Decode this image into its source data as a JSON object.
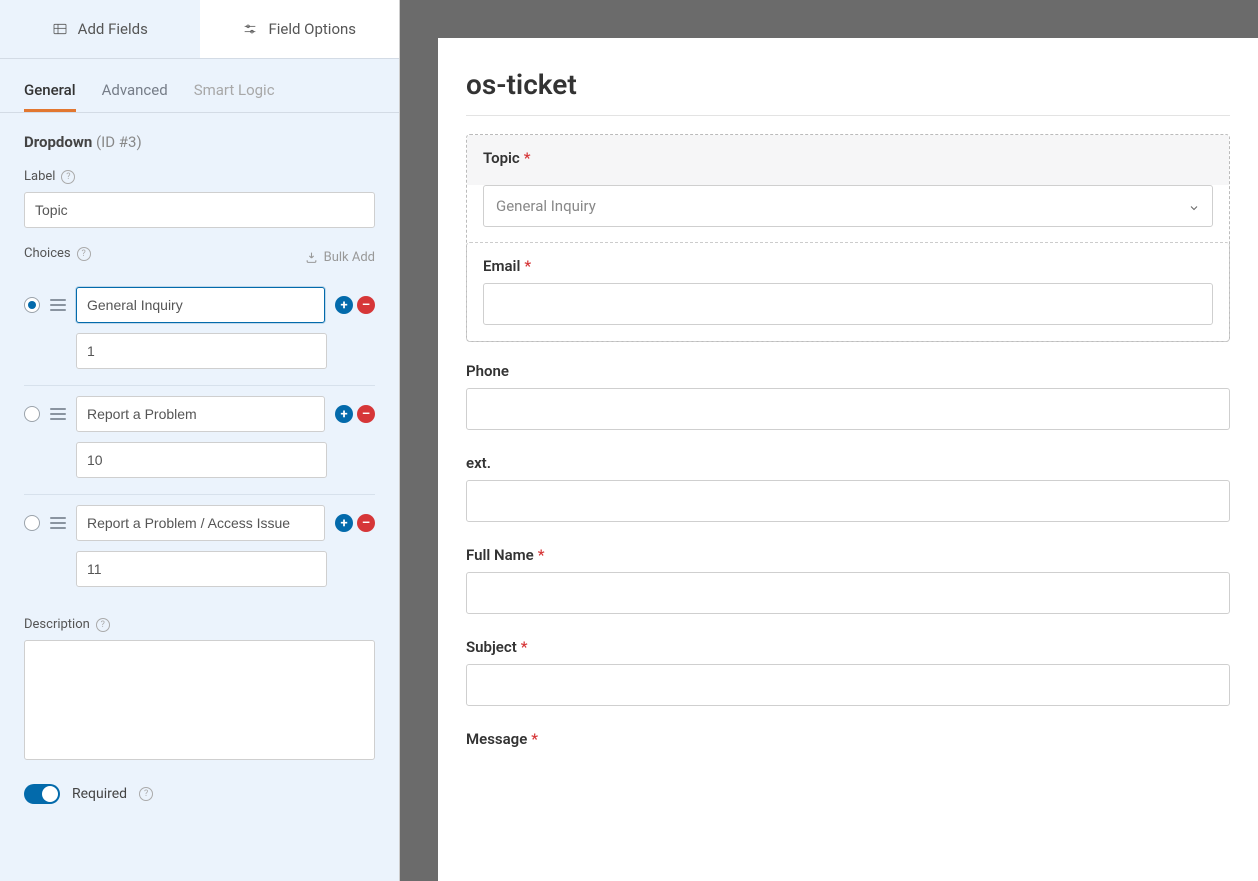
{
  "top_tabs": {
    "add_fields": "Add Fields",
    "field_options": "Field Options"
  },
  "sub_tabs": {
    "general": "General",
    "advanced": "Advanced",
    "smart_logic": "Smart Logic"
  },
  "field_type": {
    "name": "Dropdown",
    "id": "(ID #3)"
  },
  "labels": {
    "label": "Label",
    "choices": "Choices",
    "bulk_add": "Bulk Add",
    "description": "Description",
    "required": "Required"
  },
  "label_value": "Topic",
  "choices": [
    {
      "selected": true,
      "label": "General Inquiry",
      "value": "1",
      "focused": true
    },
    {
      "selected": false,
      "label": "Report a Problem",
      "value": "10",
      "focused": false
    },
    {
      "selected": false,
      "label": "Report a Problem / Access Issue",
      "value": "11",
      "focused": false
    }
  ],
  "preview": {
    "form_title": "os-ticket",
    "topic_selected": "General Inquiry",
    "fields": {
      "topic": {
        "label": "Topic",
        "required": true
      },
      "email": {
        "label": "Email",
        "required": true
      },
      "phone": {
        "label": "Phone",
        "required": false
      },
      "ext": {
        "label": "ext.",
        "required": false
      },
      "full_name": {
        "label": "Full Name",
        "required": true
      },
      "subject": {
        "label": "Subject",
        "required": true
      },
      "message": {
        "label": "Message",
        "required": true
      }
    }
  }
}
